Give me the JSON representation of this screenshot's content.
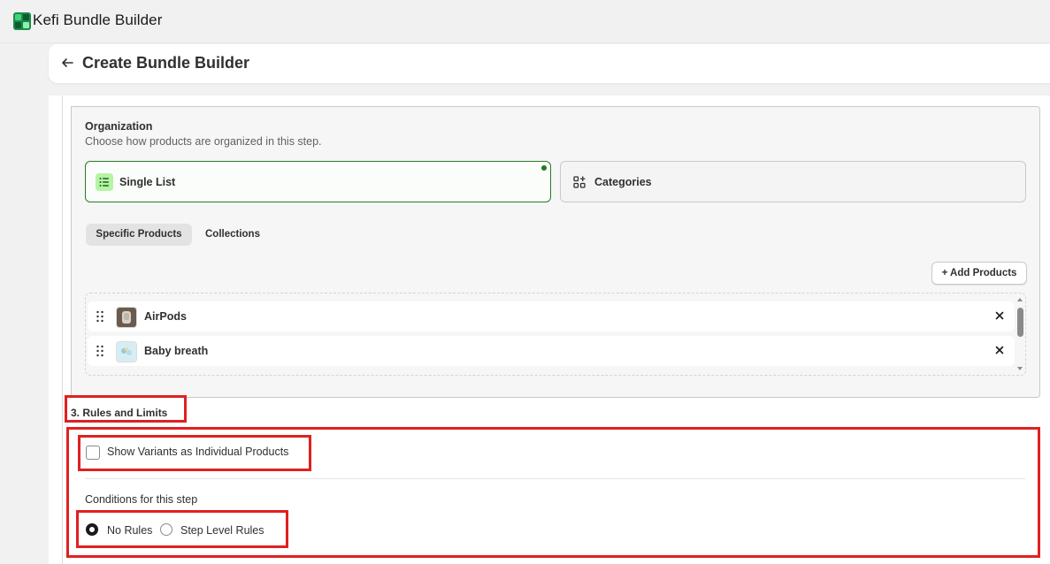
{
  "app": {
    "title": "Kefi Bundle Builder"
  },
  "header": {
    "title": "Create Bundle Builder"
  },
  "organization": {
    "title": "Organization",
    "subtitle": "Choose how products are organized in this step.",
    "options": [
      {
        "label": "Single List",
        "selected": true
      },
      {
        "label": "Categories",
        "selected": false
      }
    ],
    "tabs": [
      {
        "label": "Specific Products",
        "active": true
      },
      {
        "label": "Collections",
        "active": false
      }
    ],
    "add_button": "+ Add Products",
    "products": [
      {
        "name": "AirPods"
      },
      {
        "name": "Baby breath"
      }
    ]
  },
  "rules": {
    "title": "3. Rules and Limits",
    "variants_label": "Show Variants as Individual Products",
    "variants_checked": false,
    "conditions_label": "Conditions for this step",
    "options": [
      {
        "label": "No Rules",
        "selected": true
      },
      {
        "label": "Step Level Rules",
        "selected": false
      }
    ]
  },
  "colors": {
    "highlight": "#e02020",
    "selected_border": "#2c7a2c",
    "selected_icon_bg": "#b6f3a5"
  }
}
